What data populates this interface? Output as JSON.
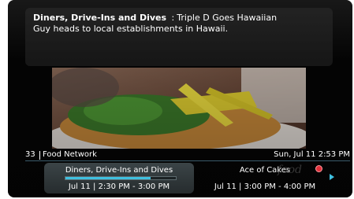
{
  "show_info": {
    "title": "Diners, Drive-Ins and Dives",
    "separator": ":",
    "episode": "Triple D Goes Hawaiian",
    "description": "Guy heads to local establishments in Hawaii."
  },
  "channel_bar": {
    "number": "33",
    "name": "Food Network",
    "clock": "Sun, Jul 11 2:53 PM"
  },
  "guide": {
    "current": {
      "name": "Diners, Drive-Ins and Dives",
      "time": "Jul 11 | 2:30 PM - 3:00 PM",
      "progress": 0.77
    },
    "next": {
      "name": "Ace of Cakes",
      "time": "Jul 11 | 3:00 PM - 4:00 PM"
    },
    "network_logo": "food"
  },
  "colors": {
    "accent": "#3fc0e0",
    "record": "#e0303a"
  }
}
